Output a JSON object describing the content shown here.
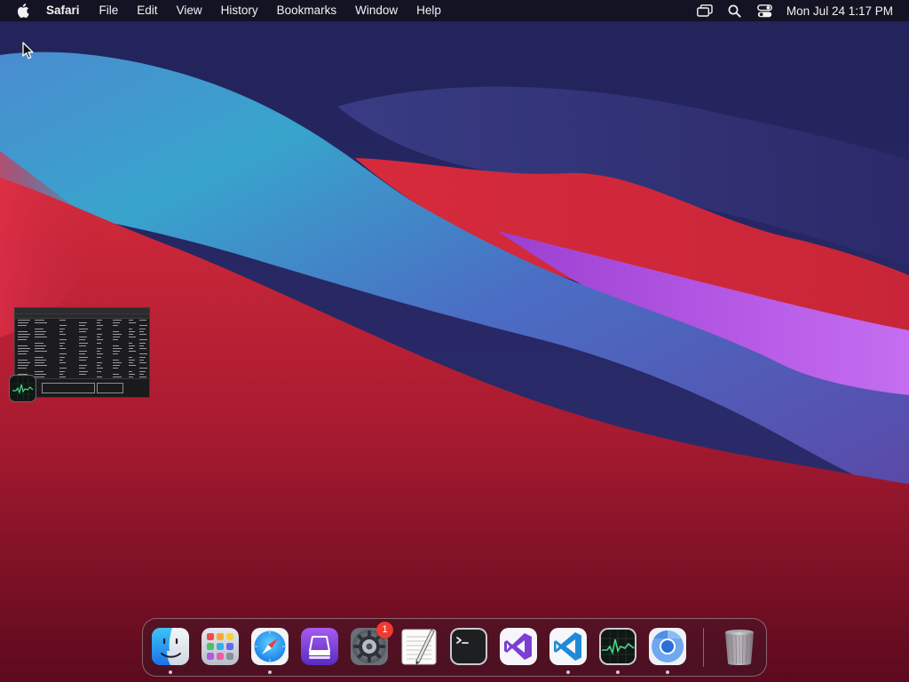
{
  "menubar": {
    "app_name": "Safari",
    "menus": [
      "File",
      "Edit",
      "View",
      "History",
      "Bookmarks",
      "Window",
      "Help"
    ],
    "status_icons": [
      "screen-mirroring-icon",
      "spotlight-search-icon",
      "control-center-icon"
    ],
    "clock": "Mon Jul 24  1:17 PM"
  },
  "minimized_window": {
    "app": "Activity Monitor",
    "badge_icon": "activity-monitor-icon"
  },
  "dock": {
    "items": [
      {
        "id": "finder",
        "icon": "finder-icon",
        "running": true
      },
      {
        "id": "launchpad",
        "icon": "launchpad-icon",
        "running": false
      },
      {
        "id": "safari",
        "icon": "safari-icon",
        "running": true
      },
      {
        "id": "apple-configurator",
        "icon": "configurator-icon",
        "running": false
      },
      {
        "id": "system-preferences",
        "icon": "gear-icon",
        "running": false,
        "badge": "1"
      },
      {
        "id": "textedit",
        "icon": "textedit-icon",
        "running": false
      },
      {
        "id": "terminal",
        "icon": "terminal-icon",
        "running": false
      },
      {
        "id": "visual-studio",
        "icon": "visual-studio-icon",
        "running": false
      },
      {
        "id": "vscode",
        "icon": "vscode-icon",
        "running": true
      },
      {
        "id": "activity-monitor",
        "icon": "activity-monitor-icon",
        "running": true
      },
      {
        "id": "chromium",
        "icon": "chromium-icon",
        "running": true
      },
      {
        "id": "trash",
        "icon": "trash-icon",
        "running": false
      }
    ]
  },
  "colors": {
    "menubar_bg": "#14121e",
    "badge_red": "#f03b30",
    "wallpaper_top": "#26296a",
    "wallpaper_teal": "#38a0c8",
    "wallpaper_red": "#d8283a",
    "wallpaper_magenta": "#b052e0"
  }
}
